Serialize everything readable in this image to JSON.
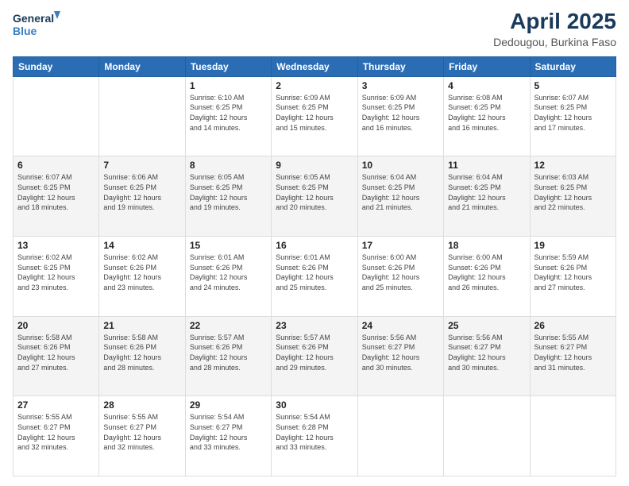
{
  "header": {
    "logo_line1": "General",
    "logo_line2": "Blue",
    "month": "April 2025",
    "location": "Dedougou, Burkina Faso"
  },
  "weekdays": [
    "Sunday",
    "Monday",
    "Tuesday",
    "Wednesday",
    "Thursday",
    "Friday",
    "Saturday"
  ],
  "weeks": [
    [
      {
        "day": "",
        "info": ""
      },
      {
        "day": "",
        "info": ""
      },
      {
        "day": "1",
        "info": "Sunrise: 6:10 AM\nSunset: 6:25 PM\nDaylight: 12 hours\nand 14 minutes."
      },
      {
        "day": "2",
        "info": "Sunrise: 6:09 AM\nSunset: 6:25 PM\nDaylight: 12 hours\nand 15 minutes."
      },
      {
        "day": "3",
        "info": "Sunrise: 6:09 AM\nSunset: 6:25 PM\nDaylight: 12 hours\nand 16 minutes."
      },
      {
        "day": "4",
        "info": "Sunrise: 6:08 AM\nSunset: 6:25 PM\nDaylight: 12 hours\nand 16 minutes."
      },
      {
        "day": "5",
        "info": "Sunrise: 6:07 AM\nSunset: 6:25 PM\nDaylight: 12 hours\nand 17 minutes."
      }
    ],
    [
      {
        "day": "6",
        "info": "Sunrise: 6:07 AM\nSunset: 6:25 PM\nDaylight: 12 hours\nand 18 minutes."
      },
      {
        "day": "7",
        "info": "Sunrise: 6:06 AM\nSunset: 6:25 PM\nDaylight: 12 hours\nand 19 minutes."
      },
      {
        "day": "8",
        "info": "Sunrise: 6:05 AM\nSunset: 6:25 PM\nDaylight: 12 hours\nand 19 minutes."
      },
      {
        "day": "9",
        "info": "Sunrise: 6:05 AM\nSunset: 6:25 PM\nDaylight: 12 hours\nand 20 minutes."
      },
      {
        "day": "10",
        "info": "Sunrise: 6:04 AM\nSunset: 6:25 PM\nDaylight: 12 hours\nand 21 minutes."
      },
      {
        "day": "11",
        "info": "Sunrise: 6:04 AM\nSunset: 6:25 PM\nDaylight: 12 hours\nand 21 minutes."
      },
      {
        "day": "12",
        "info": "Sunrise: 6:03 AM\nSunset: 6:25 PM\nDaylight: 12 hours\nand 22 minutes."
      }
    ],
    [
      {
        "day": "13",
        "info": "Sunrise: 6:02 AM\nSunset: 6:25 PM\nDaylight: 12 hours\nand 23 minutes."
      },
      {
        "day": "14",
        "info": "Sunrise: 6:02 AM\nSunset: 6:26 PM\nDaylight: 12 hours\nand 23 minutes."
      },
      {
        "day": "15",
        "info": "Sunrise: 6:01 AM\nSunset: 6:26 PM\nDaylight: 12 hours\nand 24 minutes."
      },
      {
        "day": "16",
        "info": "Sunrise: 6:01 AM\nSunset: 6:26 PM\nDaylight: 12 hours\nand 25 minutes."
      },
      {
        "day": "17",
        "info": "Sunrise: 6:00 AM\nSunset: 6:26 PM\nDaylight: 12 hours\nand 25 minutes."
      },
      {
        "day": "18",
        "info": "Sunrise: 6:00 AM\nSunset: 6:26 PM\nDaylight: 12 hours\nand 26 minutes."
      },
      {
        "day": "19",
        "info": "Sunrise: 5:59 AM\nSunset: 6:26 PM\nDaylight: 12 hours\nand 27 minutes."
      }
    ],
    [
      {
        "day": "20",
        "info": "Sunrise: 5:58 AM\nSunset: 6:26 PM\nDaylight: 12 hours\nand 27 minutes."
      },
      {
        "day": "21",
        "info": "Sunrise: 5:58 AM\nSunset: 6:26 PM\nDaylight: 12 hours\nand 28 minutes."
      },
      {
        "day": "22",
        "info": "Sunrise: 5:57 AM\nSunset: 6:26 PM\nDaylight: 12 hours\nand 28 minutes."
      },
      {
        "day": "23",
        "info": "Sunrise: 5:57 AM\nSunset: 6:26 PM\nDaylight: 12 hours\nand 29 minutes."
      },
      {
        "day": "24",
        "info": "Sunrise: 5:56 AM\nSunset: 6:27 PM\nDaylight: 12 hours\nand 30 minutes."
      },
      {
        "day": "25",
        "info": "Sunrise: 5:56 AM\nSunset: 6:27 PM\nDaylight: 12 hours\nand 30 minutes."
      },
      {
        "day": "26",
        "info": "Sunrise: 5:55 AM\nSunset: 6:27 PM\nDaylight: 12 hours\nand 31 minutes."
      }
    ],
    [
      {
        "day": "27",
        "info": "Sunrise: 5:55 AM\nSunset: 6:27 PM\nDaylight: 12 hours\nand 32 minutes."
      },
      {
        "day": "28",
        "info": "Sunrise: 5:55 AM\nSunset: 6:27 PM\nDaylight: 12 hours\nand 32 minutes."
      },
      {
        "day": "29",
        "info": "Sunrise: 5:54 AM\nSunset: 6:27 PM\nDaylight: 12 hours\nand 33 minutes."
      },
      {
        "day": "30",
        "info": "Sunrise: 5:54 AM\nSunset: 6:28 PM\nDaylight: 12 hours\nand 33 minutes."
      },
      {
        "day": "",
        "info": ""
      },
      {
        "day": "",
        "info": ""
      },
      {
        "day": "",
        "info": ""
      }
    ]
  ]
}
